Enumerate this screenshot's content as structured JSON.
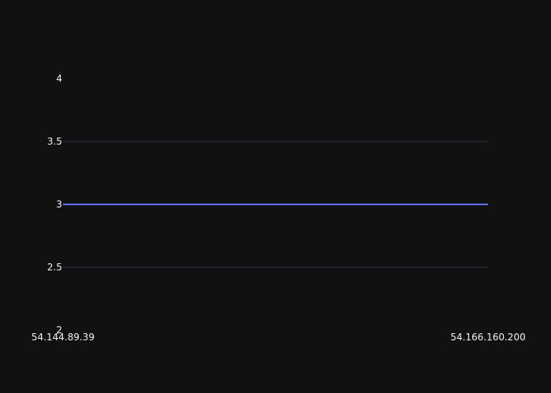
{
  "chart_data": {
    "type": "line",
    "x": [
      "54.144.89.39",
      "54.166.160.200"
    ],
    "series": [
      {
        "values": [
          3,
          3
        ]
      }
    ],
    "ylim": [
      2,
      4
    ],
    "y_ticks": [
      2,
      2.5,
      3,
      3.5,
      4
    ],
    "y_tick_labels": [
      "2",
      "2.5",
      "3",
      "3.5",
      "4"
    ],
    "x_tick_labels": [
      "54.144.89.39",
      "54.166.160.200"
    ],
    "title": "",
    "xlabel": "",
    "ylabel": "",
    "grid": true,
    "line_color": "#636efa",
    "background": "#111111"
  }
}
